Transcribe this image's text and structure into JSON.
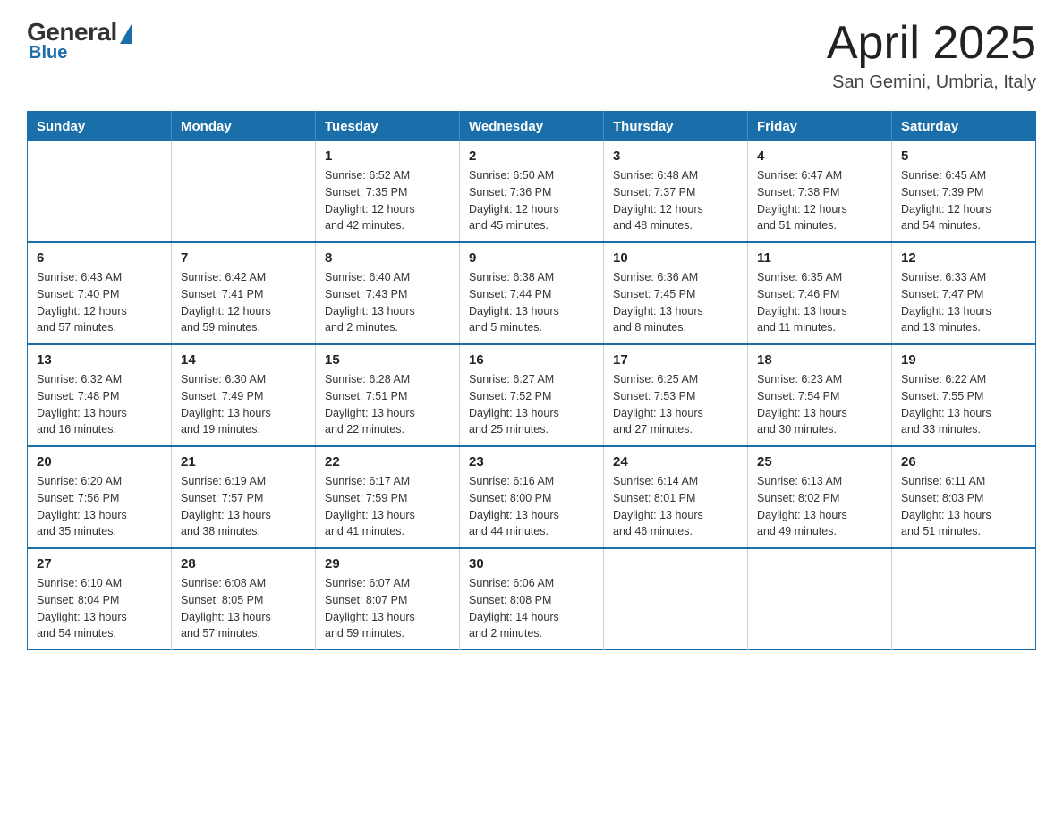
{
  "header": {
    "logo": {
      "general": "General",
      "blue": "Blue"
    },
    "title": "April 2025",
    "location": "San Gemini, Umbria, Italy"
  },
  "days_of_week": [
    "Sunday",
    "Monday",
    "Tuesday",
    "Wednesday",
    "Thursday",
    "Friday",
    "Saturday"
  ],
  "weeks": [
    [
      {
        "day": "",
        "info": ""
      },
      {
        "day": "",
        "info": ""
      },
      {
        "day": "1",
        "info": "Sunrise: 6:52 AM\nSunset: 7:35 PM\nDaylight: 12 hours\nand 42 minutes."
      },
      {
        "day": "2",
        "info": "Sunrise: 6:50 AM\nSunset: 7:36 PM\nDaylight: 12 hours\nand 45 minutes."
      },
      {
        "day": "3",
        "info": "Sunrise: 6:48 AM\nSunset: 7:37 PM\nDaylight: 12 hours\nand 48 minutes."
      },
      {
        "day": "4",
        "info": "Sunrise: 6:47 AM\nSunset: 7:38 PM\nDaylight: 12 hours\nand 51 minutes."
      },
      {
        "day": "5",
        "info": "Sunrise: 6:45 AM\nSunset: 7:39 PM\nDaylight: 12 hours\nand 54 minutes."
      }
    ],
    [
      {
        "day": "6",
        "info": "Sunrise: 6:43 AM\nSunset: 7:40 PM\nDaylight: 12 hours\nand 57 minutes."
      },
      {
        "day": "7",
        "info": "Sunrise: 6:42 AM\nSunset: 7:41 PM\nDaylight: 12 hours\nand 59 minutes."
      },
      {
        "day": "8",
        "info": "Sunrise: 6:40 AM\nSunset: 7:43 PM\nDaylight: 13 hours\nand 2 minutes."
      },
      {
        "day": "9",
        "info": "Sunrise: 6:38 AM\nSunset: 7:44 PM\nDaylight: 13 hours\nand 5 minutes."
      },
      {
        "day": "10",
        "info": "Sunrise: 6:36 AM\nSunset: 7:45 PM\nDaylight: 13 hours\nand 8 minutes."
      },
      {
        "day": "11",
        "info": "Sunrise: 6:35 AM\nSunset: 7:46 PM\nDaylight: 13 hours\nand 11 minutes."
      },
      {
        "day": "12",
        "info": "Sunrise: 6:33 AM\nSunset: 7:47 PM\nDaylight: 13 hours\nand 13 minutes."
      }
    ],
    [
      {
        "day": "13",
        "info": "Sunrise: 6:32 AM\nSunset: 7:48 PM\nDaylight: 13 hours\nand 16 minutes."
      },
      {
        "day": "14",
        "info": "Sunrise: 6:30 AM\nSunset: 7:49 PM\nDaylight: 13 hours\nand 19 minutes."
      },
      {
        "day": "15",
        "info": "Sunrise: 6:28 AM\nSunset: 7:51 PM\nDaylight: 13 hours\nand 22 minutes."
      },
      {
        "day": "16",
        "info": "Sunrise: 6:27 AM\nSunset: 7:52 PM\nDaylight: 13 hours\nand 25 minutes."
      },
      {
        "day": "17",
        "info": "Sunrise: 6:25 AM\nSunset: 7:53 PM\nDaylight: 13 hours\nand 27 minutes."
      },
      {
        "day": "18",
        "info": "Sunrise: 6:23 AM\nSunset: 7:54 PM\nDaylight: 13 hours\nand 30 minutes."
      },
      {
        "day": "19",
        "info": "Sunrise: 6:22 AM\nSunset: 7:55 PM\nDaylight: 13 hours\nand 33 minutes."
      }
    ],
    [
      {
        "day": "20",
        "info": "Sunrise: 6:20 AM\nSunset: 7:56 PM\nDaylight: 13 hours\nand 35 minutes."
      },
      {
        "day": "21",
        "info": "Sunrise: 6:19 AM\nSunset: 7:57 PM\nDaylight: 13 hours\nand 38 minutes."
      },
      {
        "day": "22",
        "info": "Sunrise: 6:17 AM\nSunset: 7:59 PM\nDaylight: 13 hours\nand 41 minutes."
      },
      {
        "day": "23",
        "info": "Sunrise: 6:16 AM\nSunset: 8:00 PM\nDaylight: 13 hours\nand 44 minutes."
      },
      {
        "day": "24",
        "info": "Sunrise: 6:14 AM\nSunset: 8:01 PM\nDaylight: 13 hours\nand 46 minutes."
      },
      {
        "day": "25",
        "info": "Sunrise: 6:13 AM\nSunset: 8:02 PM\nDaylight: 13 hours\nand 49 minutes."
      },
      {
        "day": "26",
        "info": "Sunrise: 6:11 AM\nSunset: 8:03 PM\nDaylight: 13 hours\nand 51 minutes."
      }
    ],
    [
      {
        "day": "27",
        "info": "Sunrise: 6:10 AM\nSunset: 8:04 PM\nDaylight: 13 hours\nand 54 minutes."
      },
      {
        "day": "28",
        "info": "Sunrise: 6:08 AM\nSunset: 8:05 PM\nDaylight: 13 hours\nand 57 minutes."
      },
      {
        "day": "29",
        "info": "Sunrise: 6:07 AM\nSunset: 8:07 PM\nDaylight: 13 hours\nand 59 minutes."
      },
      {
        "day": "30",
        "info": "Sunrise: 6:06 AM\nSunset: 8:08 PM\nDaylight: 14 hours\nand 2 minutes."
      },
      {
        "day": "",
        "info": ""
      },
      {
        "day": "",
        "info": ""
      },
      {
        "day": "",
        "info": ""
      }
    ]
  ]
}
